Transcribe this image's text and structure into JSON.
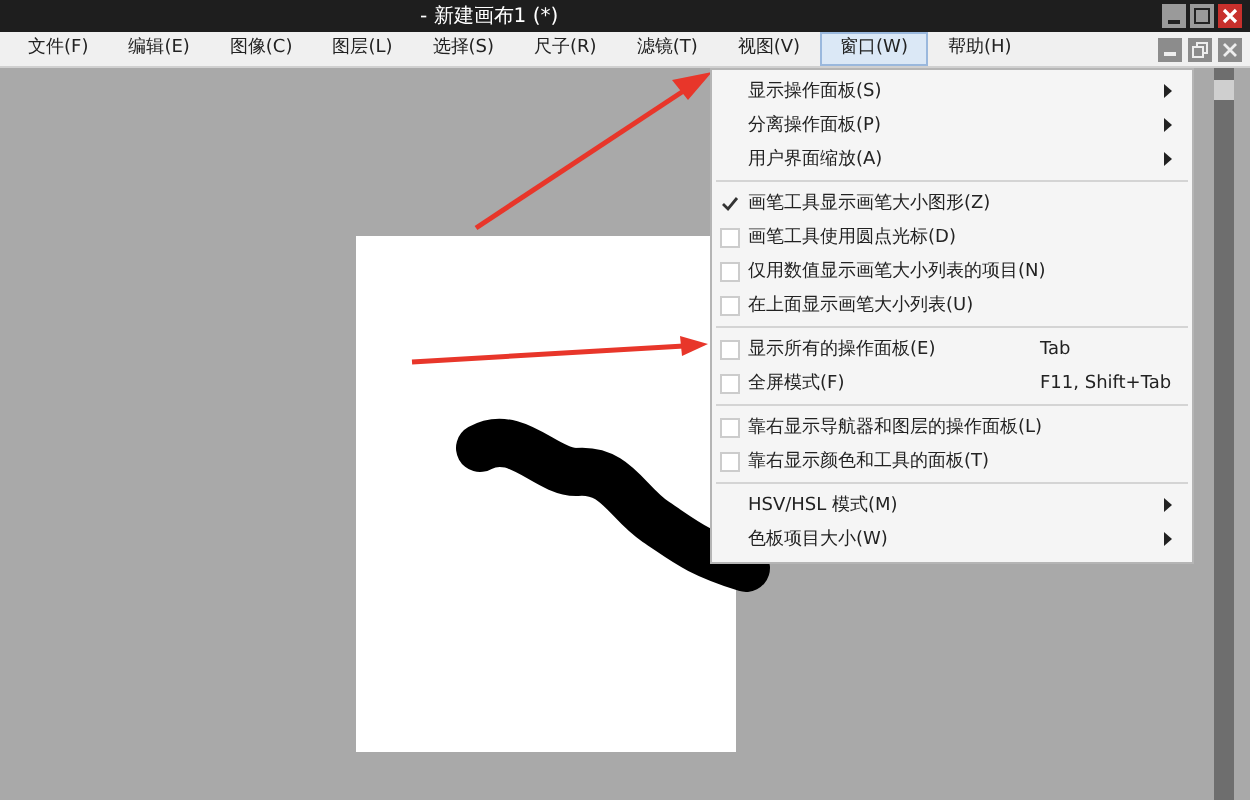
{
  "window": {
    "title": "- 新建画布1 (*)"
  },
  "menu_bar": [
    {
      "label": "文件(F)",
      "selected": false
    },
    {
      "label": "编辑(E)",
      "selected": false
    },
    {
      "label": "图像(C)",
      "selected": false
    },
    {
      "label": "图层(L)",
      "selected": false
    },
    {
      "label": "选择(S)",
      "selected": false
    },
    {
      "label": "尺子(R)",
      "selected": false
    },
    {
      "label": "滤镜(T)",
      "selected": false
    },
    {
      "label": "视图(V)",
      "selected": false
    },
    {
      "label": "窗口(W)",
      "selected": true
    },
    {
      "label": "帮助(H)",
      "selected": false
    }
  ],
  "dropdown_menu": [
    [
      {
        "kind": "submenu",
        "label": "显示操作面板(S)"
      },
      {
        "kind": "submenu",
        "label": "分离操作面板(P)"
      },
      {
        "kind": "submenu",
        "label": "用户界面缩放(A)"
      }
    ],
    [
      {
        "kind": "check",
        "label": "画笔工具显示画笔大小图形(Z)",
        "checked": true
      },
      {
        "kind": "check",
        "label": "画笔工具使用圆点光标(D)",
        "checked": false
      },
      {
        "kind": "check",
        "label": "仅用数值显示画笔大小列表的项目(N)",
        "checked": false
      },
      {
        "kind": "check",
        "label": "在上面显示画笔大小列表(U)",
        "checked": false
      }
    ],
    [
      {
        "kind": "check",
        "label": "显示所有的操作面板(E)",
        "checked": false,
        "shortcut": "Tab"
      },
      {
        "kind": "check",
        "label": "全屏模式(F)",
        "checked": false,
        "shortcut": "F11, Shift+Tab"
      }
    ],
    [
      {
        "kind": "check",
        "label": "靠右显示导航器和图层的操作面板(L)",
        "checked": false
      },
      {
        "kind": "check",
        "label": "靠右显示颜色和工具的面板(T)",
        "checked": false
      }
    ],
    [
      {
        "kind": "submenu",
        "label": "HSV/HSL 模式(M)"
      },
      {
        "kind": "submenu",
        "label": "色板项目大小(W)"
      }
    ]
  ]
}
